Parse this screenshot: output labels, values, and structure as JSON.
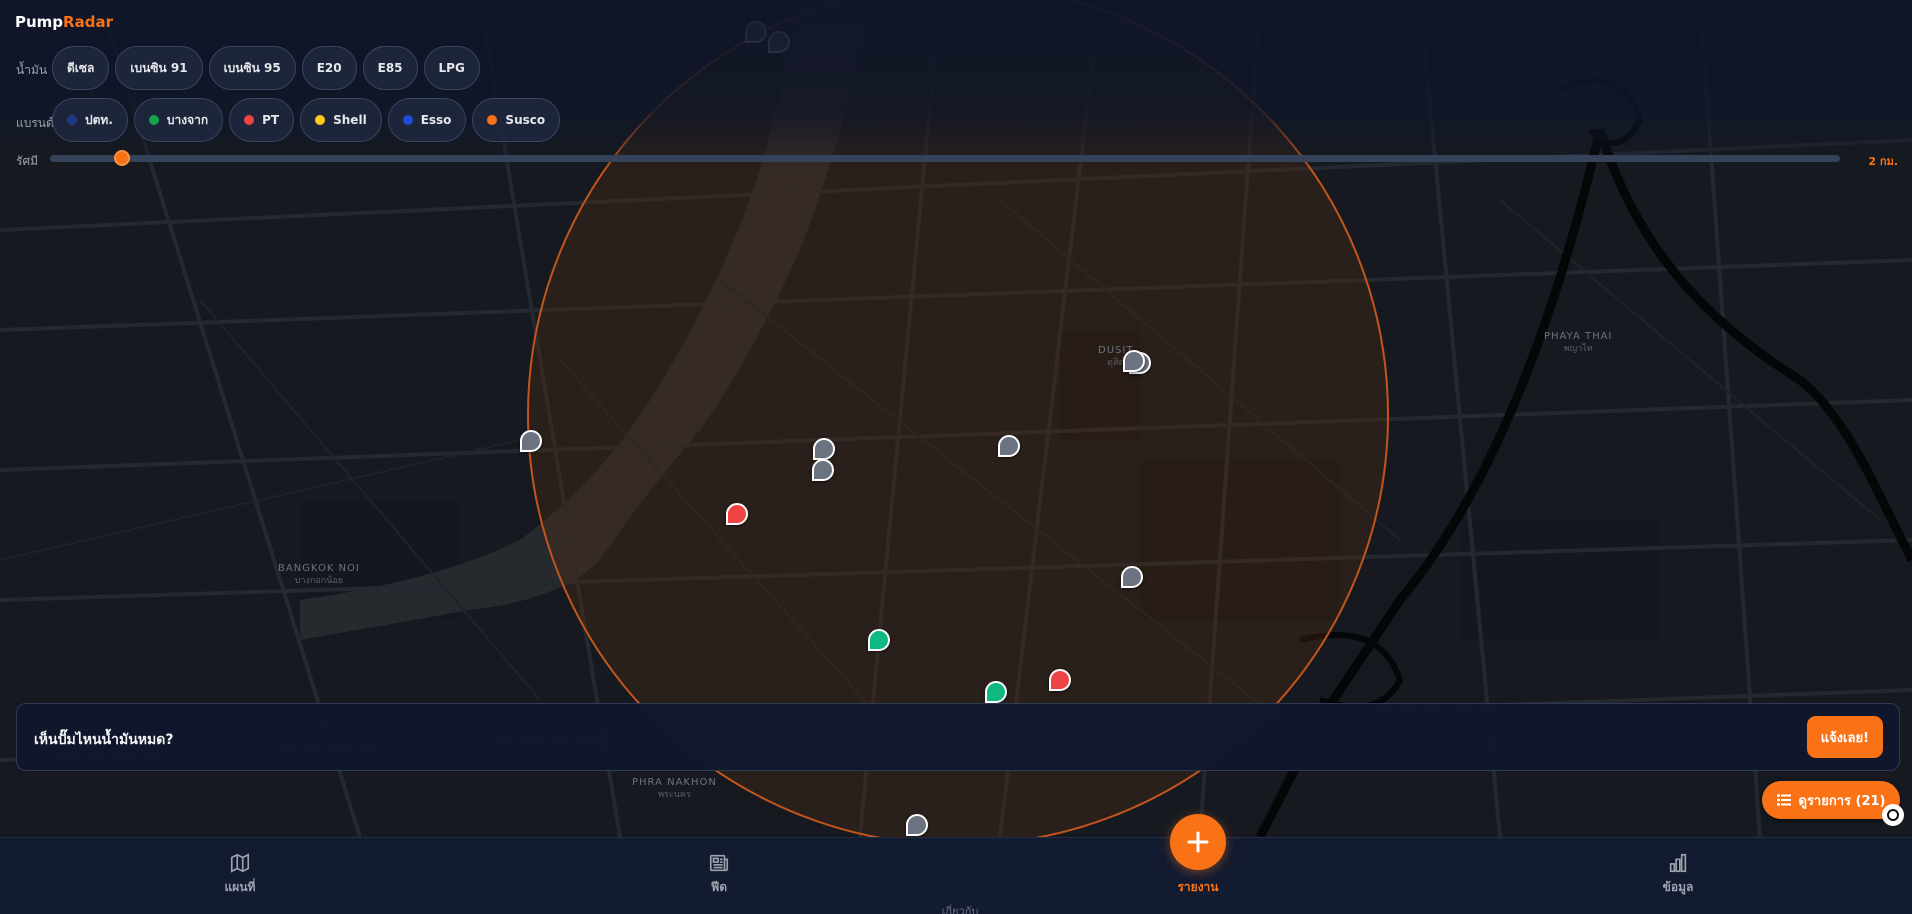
{
  "app": {
    "brand": {
      "name_primary": "Pump",
      "name_accent": "Radar"
    }
  },
  "colors": {
    "accent": "#f97316",
    "panel": "#111a2e",
    "map_background": "#161a20",
    "pin_unknown": "#6b7280",
    "pin_red": "#ef4444",
    "pin_green": "#10b981"
  },
  "filters": {
    "fuel": {
      "label": "น้ำมัน",
      "options": [
        "ดีเซล",
        "เบนซิน 91",
        "เบนซิน 95",
        "E20",
        "E85",
        "LPG"
      ]
    },
    "brand": {
      "label": "แบรนด์",
      "options": [
        {
          "name": "ปตท.",
          "color": "#1e3a8a"
        },
        {
          "name": "บางจาก",
          "color": "#16a34a"
        },
        {
          "name": "PT",
          "color": "#ef4444"
        },
        {
          "name": "Shell",
          "color": "#facc15"
        },
        {
          "name": "Esso",
          "color": "#1d4ed8"
        },
        {
          "name": "Susco",
          "color": "#f97316"
        }
      ]
    },
    "radius": {
      "label": "รัศมี",
      "value": "2 กม.",
      "fraction": 0.04
    }
  },
  "map": {
    "labels": [
      {
        "text": "DUSIT",
        "sub": "ดุสิต"
      },
      {
        "text": "BANGKOK NOI",
        "sub": "บางกอกน้อย"
      },
      {
        "text": "PHAYA THAI",
        "sub": "พญาไท"
      },
      {
        "text": "PHRA NAKHON",
        "sub": "พระนคร"
      }
    ],
    "pins": [
      {
        "color": "#6b7280"
      },
      {
        "color": "#6b7280"
      },
      {
        "color": "#6b7280"
      },
      {
        "color": "#6b7280"
      },
      {
        "color": "#6b7280"
      },
      {
        "color": "#6b7280"
      },
      {
        "color": "#6b7280"
      },
      {
        "color": "#6b7280"
      },
      {
        "color": "#6b7280"
      },
      {
        "color": "#ef4444"
      },
      {
        "color": "#10b981"
      },
      {
        "color": "#10b981"
      },
      {
        "color": "#ef4444"
      },
      {
        "color": "#6b7280"
      }
    ]
  },
  "prompt": {
    "text": "เห็นปั๊มไหนน้ำมันหมด?",
    "button": "แจ้งเลย!"
  },
  "list_button": {
    "label": "ดูรายการ (21)"
  },
  "nav": {
    "map": {
      "label": "แผนที่",
      "icon": "map-icon"
    },
    "feed": {
      "label": "ฟีด",
      "icon": "newspaper-icon"
    },
    "report": {
      "label": "รายงาน",
      "icon": "plus-icon"
    },
    "data": {
      "label": "ข้อมูล",
      "icon": "bar-chart-icon"
    },
    "about": {
      "label": "เกี่ยวกับ"
    }
  }
}
